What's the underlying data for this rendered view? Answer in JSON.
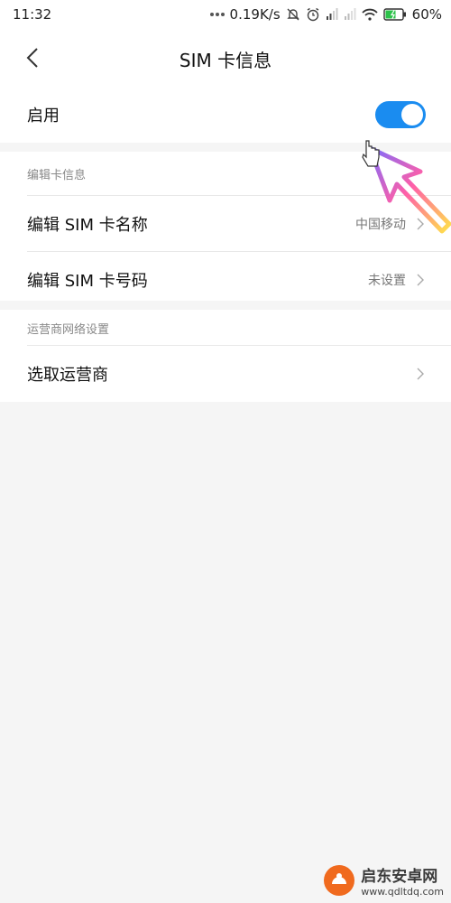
{
  "status_bar": {
    "time": "11:32",
    "network_speed": "0.19K/s",
    "battery": "60%"
  },
  "nav": {
    "title": "SIM  卡信息"
  },
  "enable": {
    "label": "启用",
    "state": "on"
  },
  "card_info": {
    "header": "编辑卡信息",
    "rows": [
      {
        "label": "编辑 SIM 卡名称",
        "value": "中国移动"
      },
      {
        "label": "编辑 SIM 卡号码",
        "value": "未设置"
      }
    ]
  },
  "carrier": {
    "header": "运营商网络设置",
    "rows": [
      {
        "label": "选取运营商",
        "value": ""
      }
    ]
  },
  "watermark": {
    "name": "启东安卓网",
    "url": "www.qdltdq.com"
  },
  "colors": {
    "accent": "#1a8cf0",
    "background": "#f5f5f5"
  }
}
